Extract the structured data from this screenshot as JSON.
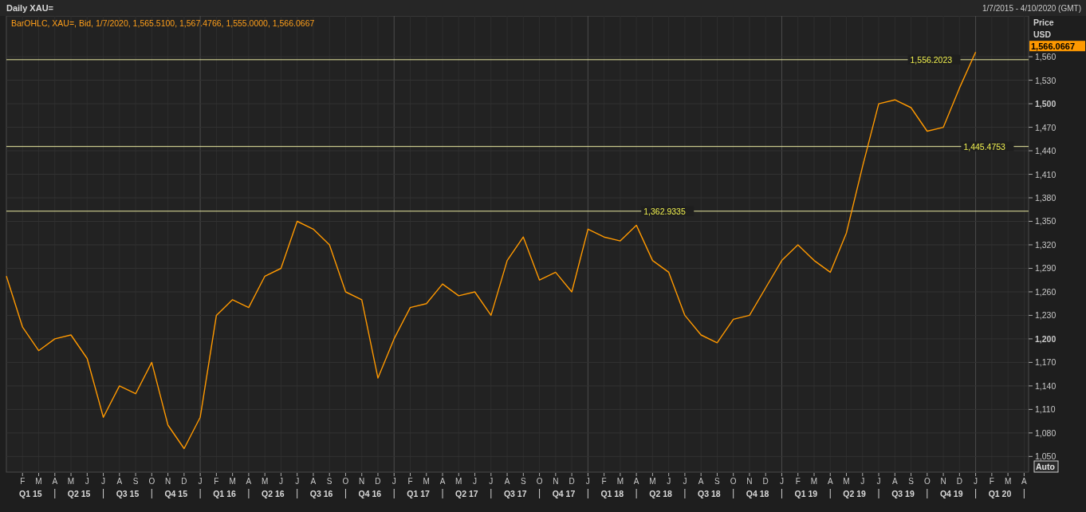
{
  "header": {
    "title": "Daily XAU=",
    "date_range": "1/7/2015 - 4/10/2020 (GMT)"
  },
  "legend": "BarOHLC, XAU=, Bid, 1/7/2020, 1,565.5100, 1,567.4766, 1,555.0000, 1,566.0667",
  "axis": {
    "title": "Price",
    "unit": "USD",
    "last_price": "1,566.0667",
    "auto_button": "Auto"
  },
  "quarters": [
    "Q1 15",
    "Q2 15",
    "Q3 15",
    "Q4 15",
    "Q1 16",
    "Q2 16",
    "Q3 16",
    "Q4 16",
    "Q1 17",
    "Q2 17",
    "Q3 17",
    "Q4 17",
    "Q1 18",
    "Q2 18",
    "Q3 18",
    "Q4 18",
    "Q1 19",
    "Q2 19",
    "Q3 19",
    "Q4 19",
    "Q1 20"
  ],
  "chart_data": {
    "type": "line",
    "ylim": [
      1030,
      1612
    ],
    "categories": [
      null,
      "F",
      "M",
      "A",
      "M",
      "J",
      "J",
      "A",
      "S",
      "O",
      "N",
      "D",
      "J",
      "F",
      "M",
      "A",
      "M",
      "J",
      "J",
      "A",
      "S",
      "O",
      "N",
      "D",
      "J",
      "F",
      "M",
      "A",
      "M",
      "J",
      "J",
      "A",
      "S",
      "O",
      "N",
      "D",
      "J",
      "F",
      "M",
      "A",
      "M",
      "J",
      "J",
      "A",
      "S",
      "O",
      "N",
      "D",
      "J",
      "F",
      "M",
      "A",
      "M",
      "J",
      "J",
      "A",
      "S",
      "O",
      "N",
      "D",
      "J",
      "F",
      "M",
      "A"
    ],
    "series": [
      {
        "color": "#ff9900",
        "values": [
          1280,
          1215,
          1185,
          1200,
          1205,
          1175,
          1100,
          1140,
          1130,
          1170,
          1090,
          1060,
          1100,
          1230,
          1250,
          1240,
          1280,
          1290,
          1350,
          1340,
          1320,
          1260,
          1250,
          1150,
          1200,
          1240,
          1245,
          1270,
          1255,
          1260,
          1230,
          1300,
          1330,
          1275,
          1285,
          1260,
          1340,
          1330,
          1325,
          1345,
          1300,
          1285,
          1230,
          1205,
          1195,
          1225,
          1230,
          1265,
          1300,
          1320,
          1300,
          1285,
          1335,
          1420,
          1500,
          1505,
          1495,
          1465,
          1470,
          1520,
          1566,
          null,
          null,
          null
        ]
      }
    ],
    "yticks": [
      {
        "value": 1050,
        "label": "1,050"
      },
      {
        "value": 1080,
        "label": "1,080"
      },
      {
        "value": 1110,
        "label": "1,110"
      },
      {
        "value": 1140,
        "label": "1,140"
      },
      {
        "value": 1170,
        "label": "1,170"
      },
      {
        "value": 1200,
        "label": "1,200"
      },
      {
        "value": 1230,
        "label": "1,230"
      },
      {
        "value": 1260,
        "label": "1,260"
      },
      {
        "value": 1290,
        "label": "1,290"
      },
      {
        "value": 1320,
        "label": "1,320"
      },
      {
        "value": 1350,
        "label": "1,350"
      },
      {
        "value": 1380,
        "label": "1,380"
      },
      {
        "value": 1410,
        "label": "1,410"
      },
      {
        "value": 1440,
        "label": "1,440"
      },
      {
        "value": 1470,
        "label": "1,470"
      },
      {
        "value": 1500,
        "label": "1,500"
      },
      {
        "value": 1530,
        "label": "1,530"
      },
      {
        "value": 1560,
        "label": "1,560"
      }
    ],
    "grid": true,
    "ref_lines": [
      {
        "axis": "y",
        "value": 1556.2023,
        "label": "1,556.2023"
      },
      {
        "axis": "y",
        "value": 1445.4753,
        "label": "1,445.4753"
      },
      {
        "axis": "y",
        "value": 1362.9335,
        "label": "1,362.9335"
      }
    ]
  }
}
